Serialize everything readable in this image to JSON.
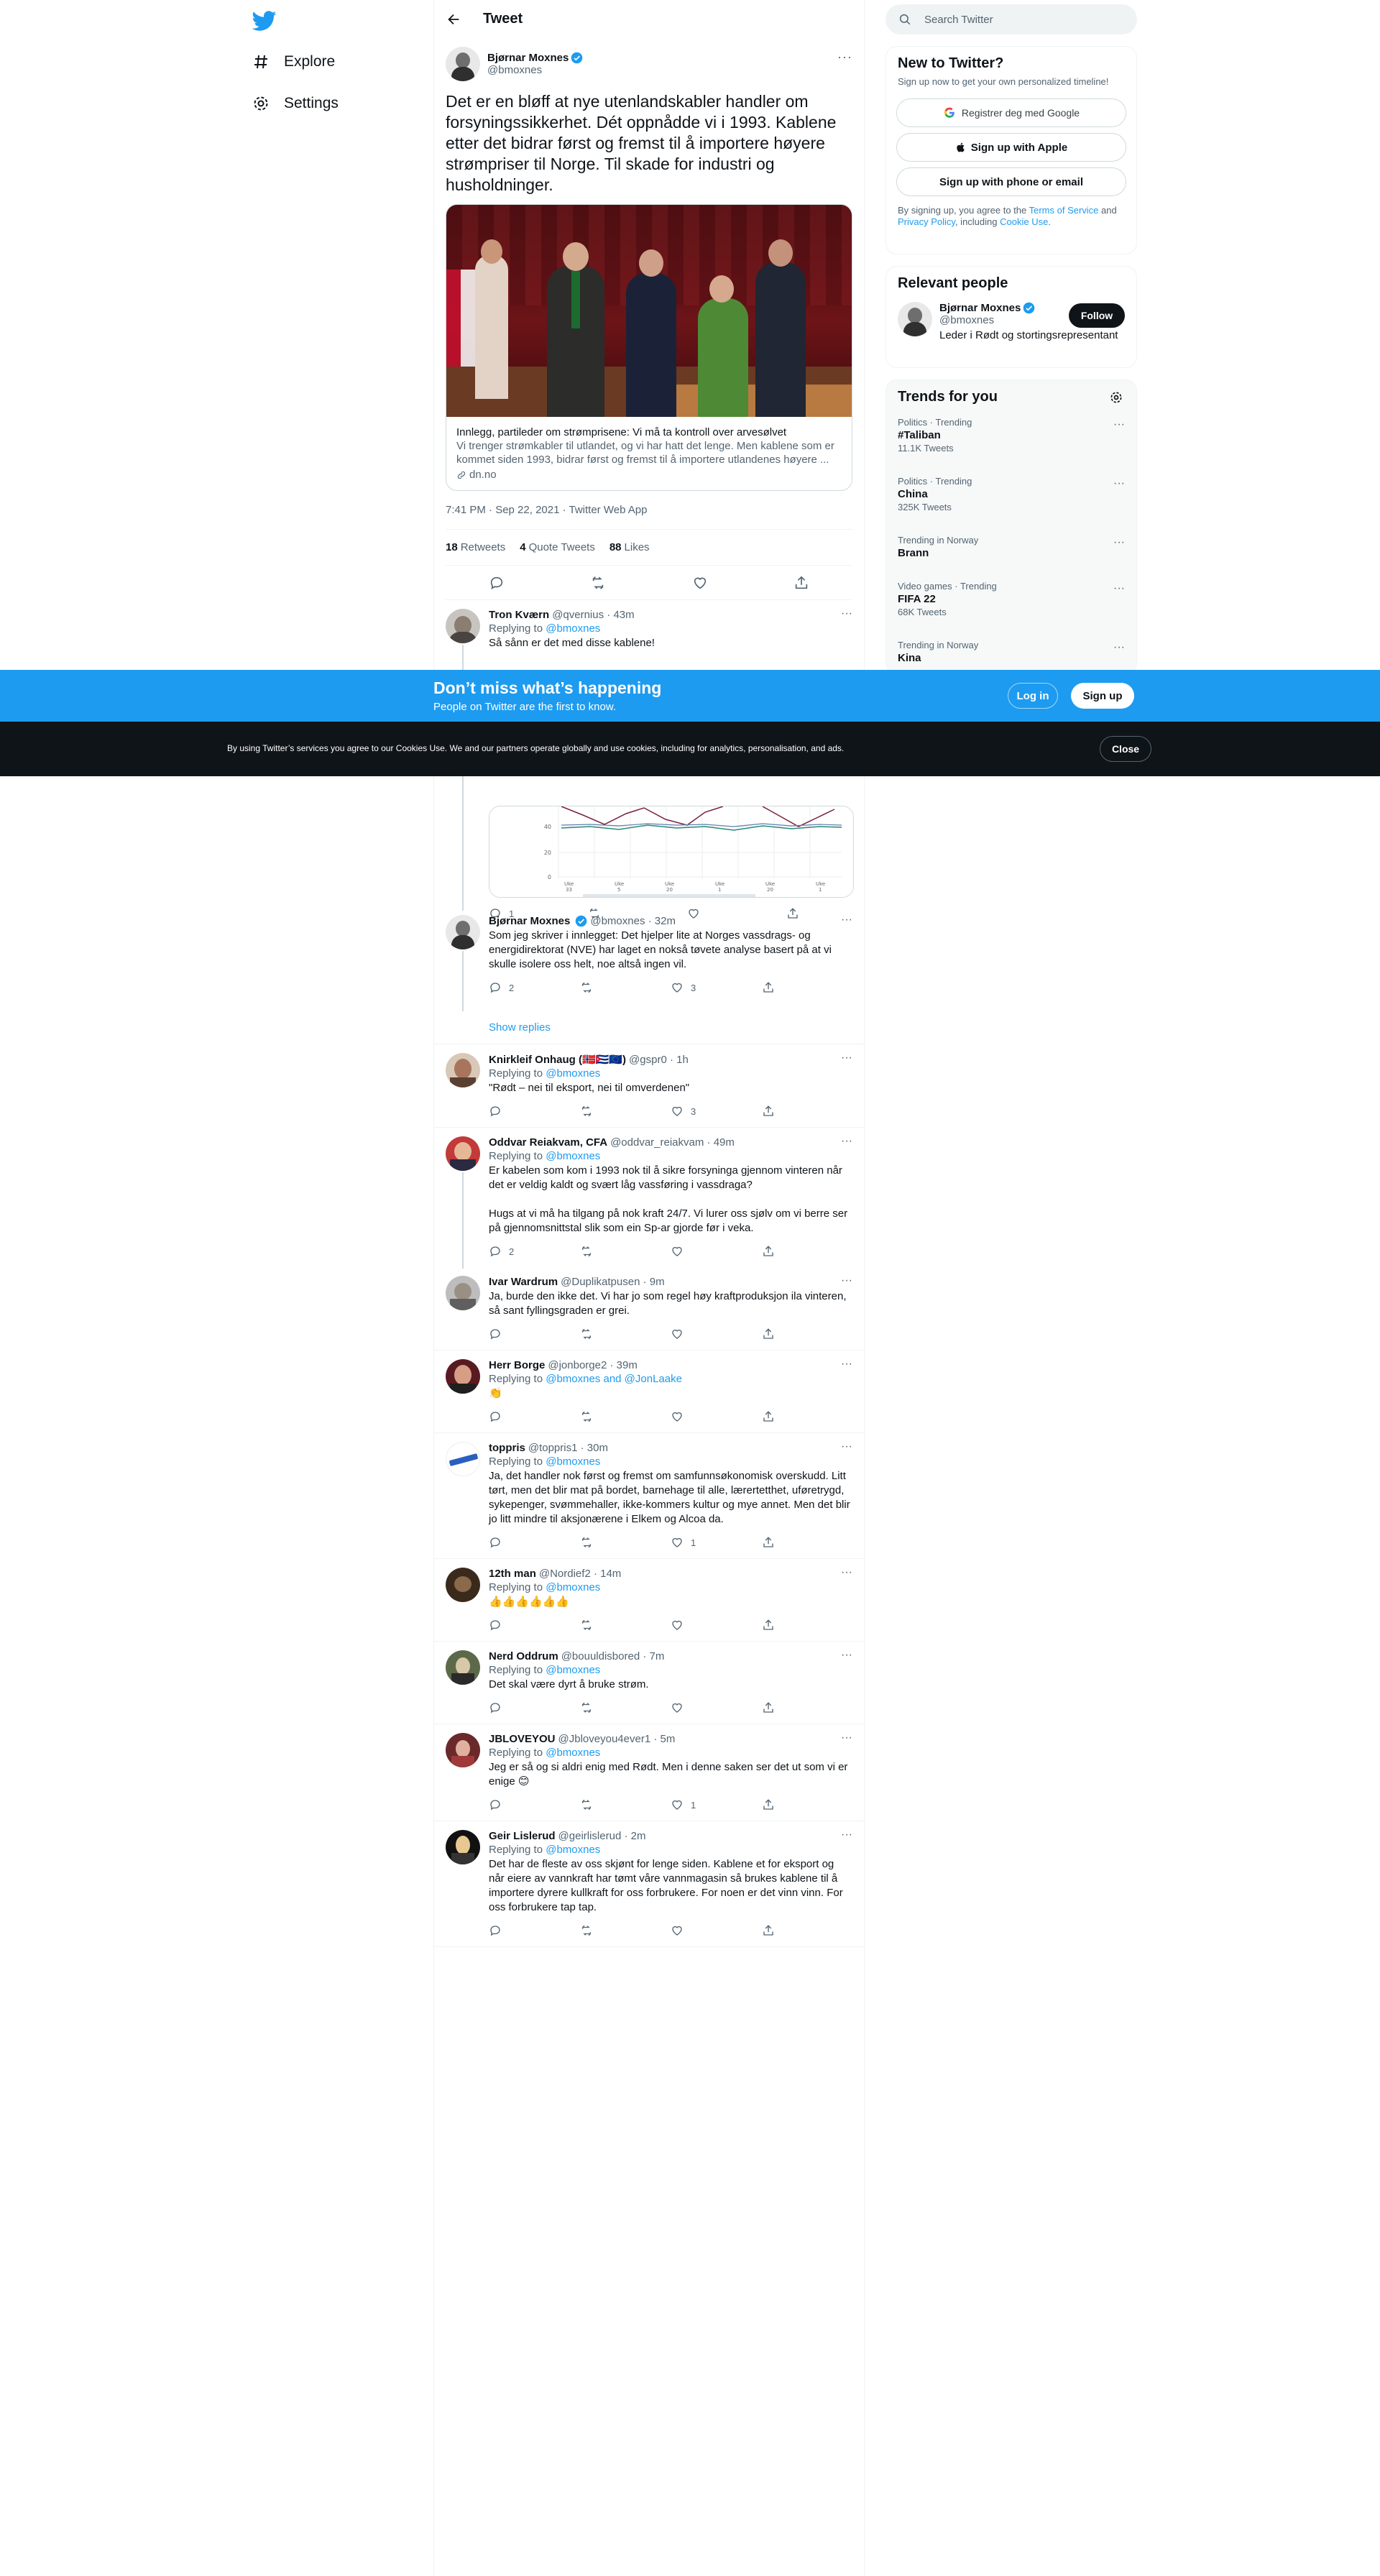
{
  "nav": {
    "explore": "Explore",
    "settings": "Settings"
  },
  "header": {
    "title": "Tweet"
  },
  "main_tweet": {
    "name": "Bjørnar Moxnes",
    "handle": "@bmoxnes",
    "text": "Det er en bløff at nye utenlandskabler handler om forsyningssikkerhet. Dét oppnådde vi i 1993. Kablene etter det bidrar først og fremst til å importere høyere strømpriser til Norge. Til skade for industri og husholdninger.",
    "card_title": "Innlegg, partileder om strømprisene: Vi må ta kontroll over arvesølvet",
    "card_desc": "Vi trenger strømkabler til utlandet, og vi har hatt det lenge. Men kablene som er kommet siden 1993, bidrar først og fremst til å importere utlandenes høyere ...",
    "card_domain": "dn.no",
    "time": "7:41 PM · Sep 22, 2021 · Twitter Web App",
    "retweets": "18",
    "retweets_label": "Retweets",
    "quotes": "4",
    "quotes_label": "Quote Tweets",
    "likes": "88",
    "likes_label": "Likes"
  },
  "replies": [
    {
      "name": "Tron Kværn",
      "handle": "@qvernius · 43m",
      "replying": "Replying to",
      "to": "@bmoxnes",
      "text": "Så sånn er det med disse kablene!",
      "reply_count": "1",
      "retweet_count": "",
      "like_count": ""
    },
    {
      "name": "Bjørnar Moxnes",
      "handle": "@bmoxnes · 32m",
      "text": "Som jeg skriver i innlegget: Det hjelper lite at Norges vassdrags- og energidirektorat (NVE) har laget en nokså tøvete analyse basert på at vi skulle isolere oss helt, noe altså ingen vil.",
      "reply_count": "2",
      "retweet_count": "",
      "like_count": "3"
    },
    {
      "name": "Knirkleif Onhaug (🇳🇴🇨🇺🇪🇺)",
      "handle": "@gspr0 · 1h",
      "replying": "Replying to",
      "to": "@bmoxnes",
      "text": "\"Rødt – nei til eksport, nei til omverdenen\"",
      "reply_count": "",
      "retweet_count": "",
      "like_count": "3"
    },
    {
      "name": "Oddvar Reiakvam, CFA",
      "handle": "@oddvar_reiakvam · 49m",
      "replying": "Replying to",
      "to": "@bmoxnes",
      "text": "Er kabelen som kom i 1993 nok til å sikre forsyninga gjennom vinteren når det er veldig kaldt og svært låg vassføring i vassdraga?",
      "text2": "Hugs at vi må ha tilgang på nok kraft 24/7. Vi lurer oss sjølv om vi berre ser på gjennomsnittstal slik som ein Sp-ar gjorde før i veka.",
      "reply_count": "2",
      "retweet_count": "",
      "like_count": ""
    },
    {
      "name": "Ivar Wardrum",
      "handle": "@Duplikatpusen · 9m",
      "text": "Ja, burde den ikke det. Vi har jo som regel høy kraftproduksjon ila vinteren, så sant fyllingsgraden er grei.",
      "reply_count": "",
      "retweet_count": "",
      "like_count": ""
    },
    {
      "name": "Herr Borge",
      "handle": "@jonborge2 · 39m",
      "replying": "Replying to",
      "to": "@bmoxnes and @JonLaake",
      "text": "👏",
      "reply_count": "",
      "retweet_count": "",
      "like_count": ""
    },
    {
      "name": "toppris",
      "handle": "@toppris1 · 30m",
      "replying": "Replying to",
      "to": "@bmoxnes",
      "text": "Ja, det handler nok først og fremst om samfunnsøkonomisk overskudd. Litt tørt, men det blir mat på bordet, barnehage til alle, lærertetthet, uføretrygd, sykepenger, svømmehaller, ikke-kommers kultur og mye annet. Men det blir jo litt mindre til aksjonærene i Elkem og Alcoa da.",
      "reply_count": "",
      "retweet_count": "",
      "like_count": "1"
    },
    {
      "name": "12th man",
      "handle": "@Nordief2 · 14m",
      "replying": "Replying to",
      "to": "@bmoxnes",
      "text": "👍👍👍👍👍👍",
      "reply_count": "",
      "retweet_count": "",
      "like_count": ""
    },
    {
      "name": "Nerd Oddrum",
      "handle": "@bouuldisbored · 7m",
      "replying": "Replying to",
      "to": "@bmoxnes",
      "text": "Det skal være dyrt å bruke strøm.",
      "reply_count": "",
      "retweet_count": "",
      "like_count": ""
    },
    {
      "name": "JBLOVEYOU",
      "handle": "@Jbloveyou4ever1 · 5m",
      "replying": "Replying to",
      "to": "@bmoxnes",
      "text": "Jeg er så og si aldri enig med Rødt. Men i denne saken ser det ut som vi er enige 😊",
      "reply_count": "",
      "retweet_count": "",
      "like_count": "1"
    },
    {
      "name": "Geir Lislerud",
      "handle": "@geirlislerud · 2m",
      "replying": "Replying to",
      "to": "@bmoxnes",
      "text": "Det har de fleste av oss skjønt for lenge siden. Kablene et for eksport og når eiere av vannkraft har tømt våre vannmagasin så brukes kablene til å importere dyrere kullkraft for oss forbrukere. For noen er det vinn vinn. For oss forbrukere tap tap.",
      "reply_count": "",
      "retweet_count": "",
      "like_count": ""
    }
  ],
  "show_replies": "Show replies",
  "search": {
    "placeholder": "Search Twitter"
  },
  "new_panel": {
    "title": "New to Twitter?",
    "sub": "Sign up now to get your own personalized timeline!",
    "google": "Registrer deg med Google",
    "apple": "Sign up with Apple",
    "phone": "Sign up with phone or email",
    "legal_a": "By signing up, you agree to the ",
    "tos": "Terms of Service",
    "legal_b": " and ",
    "privacy": "Privacy Policy",
    "legal_c": ", including ",
    "cookie": "Cookie Use",
    "legal_d": "."
  },
  "relevant": {
    "title": "Relevant people",
    "name": "Bjørnar Moxnes",
    "handle": "@bmoxnes",
    "bio": "Leder i Rødt og stortingsrepresentant",
    "follow": "Follow"
  },
  "trends": {
    "title": "Trends for you",
    "items": [
      {
        "context": "Politics · Trending",
        "topic": "#Taliban",
        "count": "11.1K Tweets"
      },
      {
        "context": "Politics · Trending",
        "topic": "China",
        "count": "325K Tweets"
      },
      {
        "context": "Trending in Norway",
        "topic": "Brann",
        "count": ""
      },
      {
        "context": "Video games · Trending",
        "topic": "FIFA 22",
        "count": "68K Tweets"
      },
      {
        "context": "Trending in Norway",
        "topic": "Kina",
        "count": ""
      }
    ]
  },
  "bottom_bar": {
    "title": "Don’t miss what’s happening",
    "sub": "People on Twitter are the first to know.",
    "login": "Log in",
    "signup": "Sign up"
  },
  "cookie_bar": {
    "text": "By using Twitter’s services you agree to our Cookies Use. We and our partners operate globally and use cookies, including for analytics, personalisation, and ads.",
    "close": "Close"
  },
  "colors": {
    "accent": "#1d9bf0",
    "text": "#0f1419",
    "muted": "#536471"
  }
}
